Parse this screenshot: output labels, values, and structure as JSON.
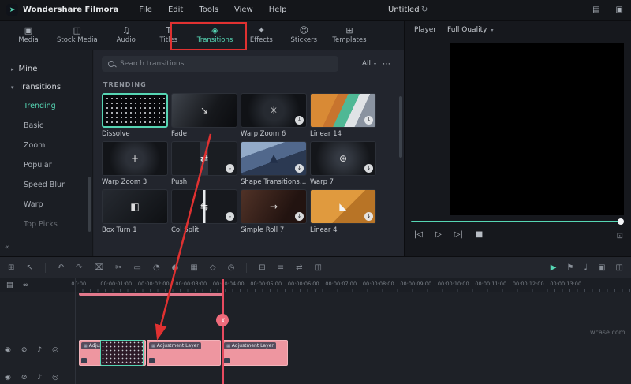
{
  "colors": {
    "accent": "#56d6b4",
    "annotation": "#e03131",
    "clip": "#ee96a0",
    "playhead": "#e84a5f"
  },
  "menubar": {
    "logo_icon": "➤",
    "logo": "Wondershare Filmora",
    "menus": [
      "File",
      "Edit",
      "Tools",
      "View",
      "Help"
    ],
    "project": "Untitled",
    "sync_icon": "↻",
    "window_icons": [
      "▤",
      "▣"
    ]
  },
  "tabs": {
    "items": [
      {
        "label": "Media",
        "icon": "▣"
      },
      {
        "label": "Stock Media",
        "icon": "◫"
      },
      {
        "label": "Audio",
        "icon": "♫"
      },
      {
        "label": "Titles",
        "icon": "T"
      },
      {
        "label": "Transitions",
        "icon": "◈"
      },
      {
        "label": "Effects",
        "icon": "✦"
      },
      {
        "label": "Stickers",
        "icon": "☺"
      },
      {
        "label": "Templates",
        "icon": "⊞"
      }
    ]
  },
  "sidebar": {
    "mine": "Mine",
    "group": "Transitions",
    "caret_collapsed": "▸",
    "caret_expanded": "▾",
    "items": [
      "Trending",
      "Basic",
      "Zoom",
      "Popular",
      "Speed Blur",
      "Warp",
      "Top Picks"
    ],
    "collapse": "«"
  },
  "search": {
    "placeholder": "Search transitions",
    "filter": "All",
    "caret": "▾",
    "more": "⋯"
  },
  "trending": {
    "title": "TRENDING",
    "download_glyph": "↓",
    "items": [
      {
        "name": "Dissolve",
        "glyph": ""
      },
      {
        "name": "Fade",
        "glyph": "↘"
      },
      {
        "name": "Warp Zoom 6",
        "glyph": "✳"
      },
      {
        "name": "Linear 14",
        "glyph": ""
      },
      {
        "name": "Warp Zoom 3",
        "glyph": "+"
      },
      {
        "name": "Push",
        "glyph": "⇄"
      },
      {
        "name": "Shape Transitions Pack...",
        "glyph": "▲"
      },
      {
        "name": "Warp 7",
        "glyph": "⊛"
      },
      {
        "name": "Box Turn 1",
        "glyph": "◧"
      },
      {
        "name": "Col Split",
        "glyph": "⇆"
      },
      {
        "name": "Simple Roll 7",
        "glyph": "→"
      },
      {
        "name": "Linear 4",
        "glyph": "◣"
      }
    ]
  },
  "player": {
    "label": "Player",
    "quality": "Full Quality",
    "caret": "▾",
    "controls": [
      {
        "name": "previous-frame",
        "glyph": "|◁"
      },
      {
        "name": "play",
        "glyph": "▷"
      },
      {
        "name": "next-frame",
        "glyph": "▷|"
      },
      {
        "name": "stop",
        "glyph": "■"
      }
    ],
    "expand_icon": "⊡"
  },
  "timeline": {
    "toolbar_left": [
      {
        "name": "snap",
        "glyph": "⊞"
      },
      {
        "name": "select",
        "glyph": "↖"
      },
      {
        "name": "undo",
        "glyph": "↶"
      },
      {
        "name": "redo",
        "glyph": "↷"
      },
      {
        "name": "delete",
        "glyph": "⌧"
      },
      {
        "name": "split",
        "glyph": "✂"
      },
      {
        "name": "crop",
        "glyph": "▭"
      },
      {
        "name": "speed",
        "glyph": "◔"
      },
      {
        "name": "color",
        "glyph": "◐"
      },
      {
        "name": "mask",
        "glyph": "▦"
      },
      {
        "name": "keyframe",
        "glyph": "◇"
      },
      {
        "name": "timer",
        "glyph": "◷"
      },
      {
        "name": "properties",
        "glyph": "⊟"
      },
      {
        "name": "mixer",
        "glyph": "≡"
      },
      {
        "name": "reorder",
        "glyph": "⇄"
      },
      {
        "name": "tracks",
        "glyph": "◫"
      }
    ],
    "toolbar_right": [
      {
        "name": "render-preview",
        "glyph": "▶"
      },
      {
        "name": "marker",
        "glyph": "⚑"
      },
      {
        "name": "voiceover",
        "glyph": "♩"
      },
      {
        "name": "screen-record",
        "glyph": "▣"
      },
      {
        "name": "track-manager",
        "glyph": "◫"
      }
    ],
    "ruler": [
      "00:00",
      "00:00:01:00",
      "00:00:02:00",
      "00:00:03:00",
      "00:00:04:00",
      "00:00:05:00",
      "00:00:06:00",
      "00:00:07:00",
      "00:00:08:00",
      "00:00:09:00",
      "00:00:10:00",
      "00:00:11:00",
      "00:00:12:00",
      "00:00:13:00"
    ],
    "track_icons": {
      "media": "▤",
      "link": "∞",
      "cam": "◉",
      "lock": "⊘",
      "mute": "♪",
      "eye": "◎"
    },
    "clips": [
      {
        "label": "Adjustment Layer"
      },
      {
        "label": "Adjustment Layer"
      },
      {
        "label": "Adjustment Layer"
      }
    ]
  },
  "watermark": "wcase.com"
}
